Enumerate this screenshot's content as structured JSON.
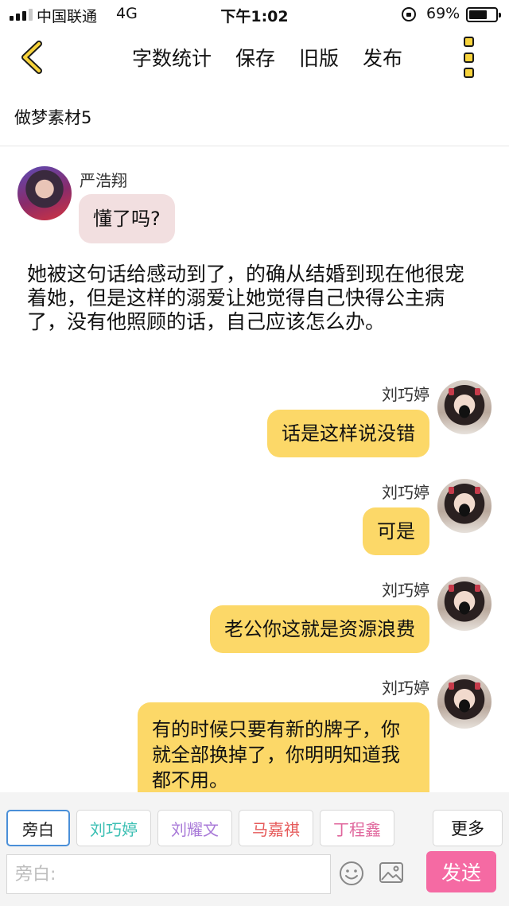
{
  "status_bar": {
    "carrier": "中国联通",
    "network": "4G",
    "time": "下午1:02",
    "battery": "69%",
    "battery_level": 0.69,
    "signal_bars": 3,
    "signal_bars_total": 4
  },
  "nav": {
    "back_icon": "chevron-left-icon",
    "actions": [
      "字数统计",
      "保存",
      "旧版",
      "发布"
    ],
    "more_icon": "more-vertical-icon",
    "accent_color": "#f7d33c"
  },
  "document": {
    "title": "做梦素材5"
  },
  "messages": [
    {
      "side": "left",
      "speaker": "严浩翔",
      "text": "懂了吗?"
    },
    {
      "side": "narration",
      "text": "她被这句话给感动到了，的确从结婚到现在他很宠着她，但是这样的溺爱让她觉得自己快得公主病了，没有他照顾的话，自己应该怎么办。"
    },
    {
      "side": "right",
      "speaker": "刘巧婷",
      "text": "话是这样说没错"
    },
    {
      "side": "right",
      "speaker": "刘巧婷",
      "text": "可是"
    },
    {
      "side": "right",
      "speaker": "刘巧婷",
      "text": "老公你这就是资源浪费"
    },
    {
      "side": "right",
      "speaker": "刘巧婷",
      "text": "有的时候只要有新的牌子，你就全部换掉了，你明明知道我都不用。"
    }
  ],
  "composer": {
    "roles": [
      {
        "label": "旁白",
        "color": "#222222"
      },
      {
        "label": "刘巧婷",
        "color": "#3bbfb3"
      },
      {
        "label": "刘耀文",
        "color": "#a97ad8"
      },
      {
        "label": "马嘉祺",
        "color": "#e65a5a"
      },
      {
        "label": "丁程鑫",
        "color": "#e0669c"
      }
    ],
    "more_label": "更多",
    "input_placeholder": "旁白:",
    "emoji_icon": "smiley-icon",
    "image_icon": "image-icon",
    "send_label": "发送",
    "send_color": "#f56aa3"
  }
}
